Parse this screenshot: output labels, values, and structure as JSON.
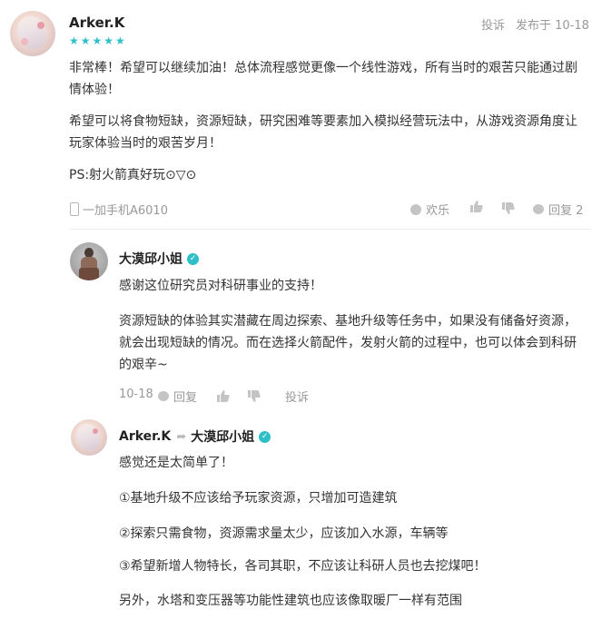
{
  "review": {
    "username": "Arker.K",
    "rating_stars": "★★★★★",
    "rating": 5,
    "report_label": "投诉",
    "date": "发布于 10-18",
    "paragraphs": [
      "非常棒！希望可以继续加油！总体流程感觉更像一个线性游戏，所有当时的艰苦只能通过剧",
      "情体验！",
      "希望可以将食物短缺，资源短缺，研究困难等要素加入模拟经营玩法中，从游戏资源角度让",
      "玩家体验当时的艰苦岁月！",
      "PS:射火箭真好玩⊙▽⊙"
    ],
    "device": "一加手机A6010",
    "happy_label": "欢乐",
    "reply_label": "回复 2"
  },
  "dev_reply": {
    "username": "大漠邱小姐",
    "lines": [
      "感谢这位研究员对科研事业的支持！",
      "资源短缺的体验其实潜藏在周边探索、基地升级等任务中，如果没有储备好资源，",
      "就会出现短缺的情况。而在选择火箭配件，发射火箭的过程中，也可以体会到科研",
      "的艰辛~"
    ],
    "date": "10-18",
    "reply_label": "回复",
    "report_label": "投诉"
  },
  "sub_reply": {
    "username": "Arker.K",
    "reply_to": "大漠邱小姐",
    "lines": [
      "感觉还是太简单了！",
      "①基地升级不应该给予玩家资源，只增加可造建筑",
      "②探索只需食物，资源需求量太少，应该加入水源，车辆等",
      "③希望新增人物特长，各司其职，不应该让科研人员也去挖煤吧！",
      "另外，水塔和变压器等功能性建筑也应该像取暖厂一样有范围"
    ]
  }
}
